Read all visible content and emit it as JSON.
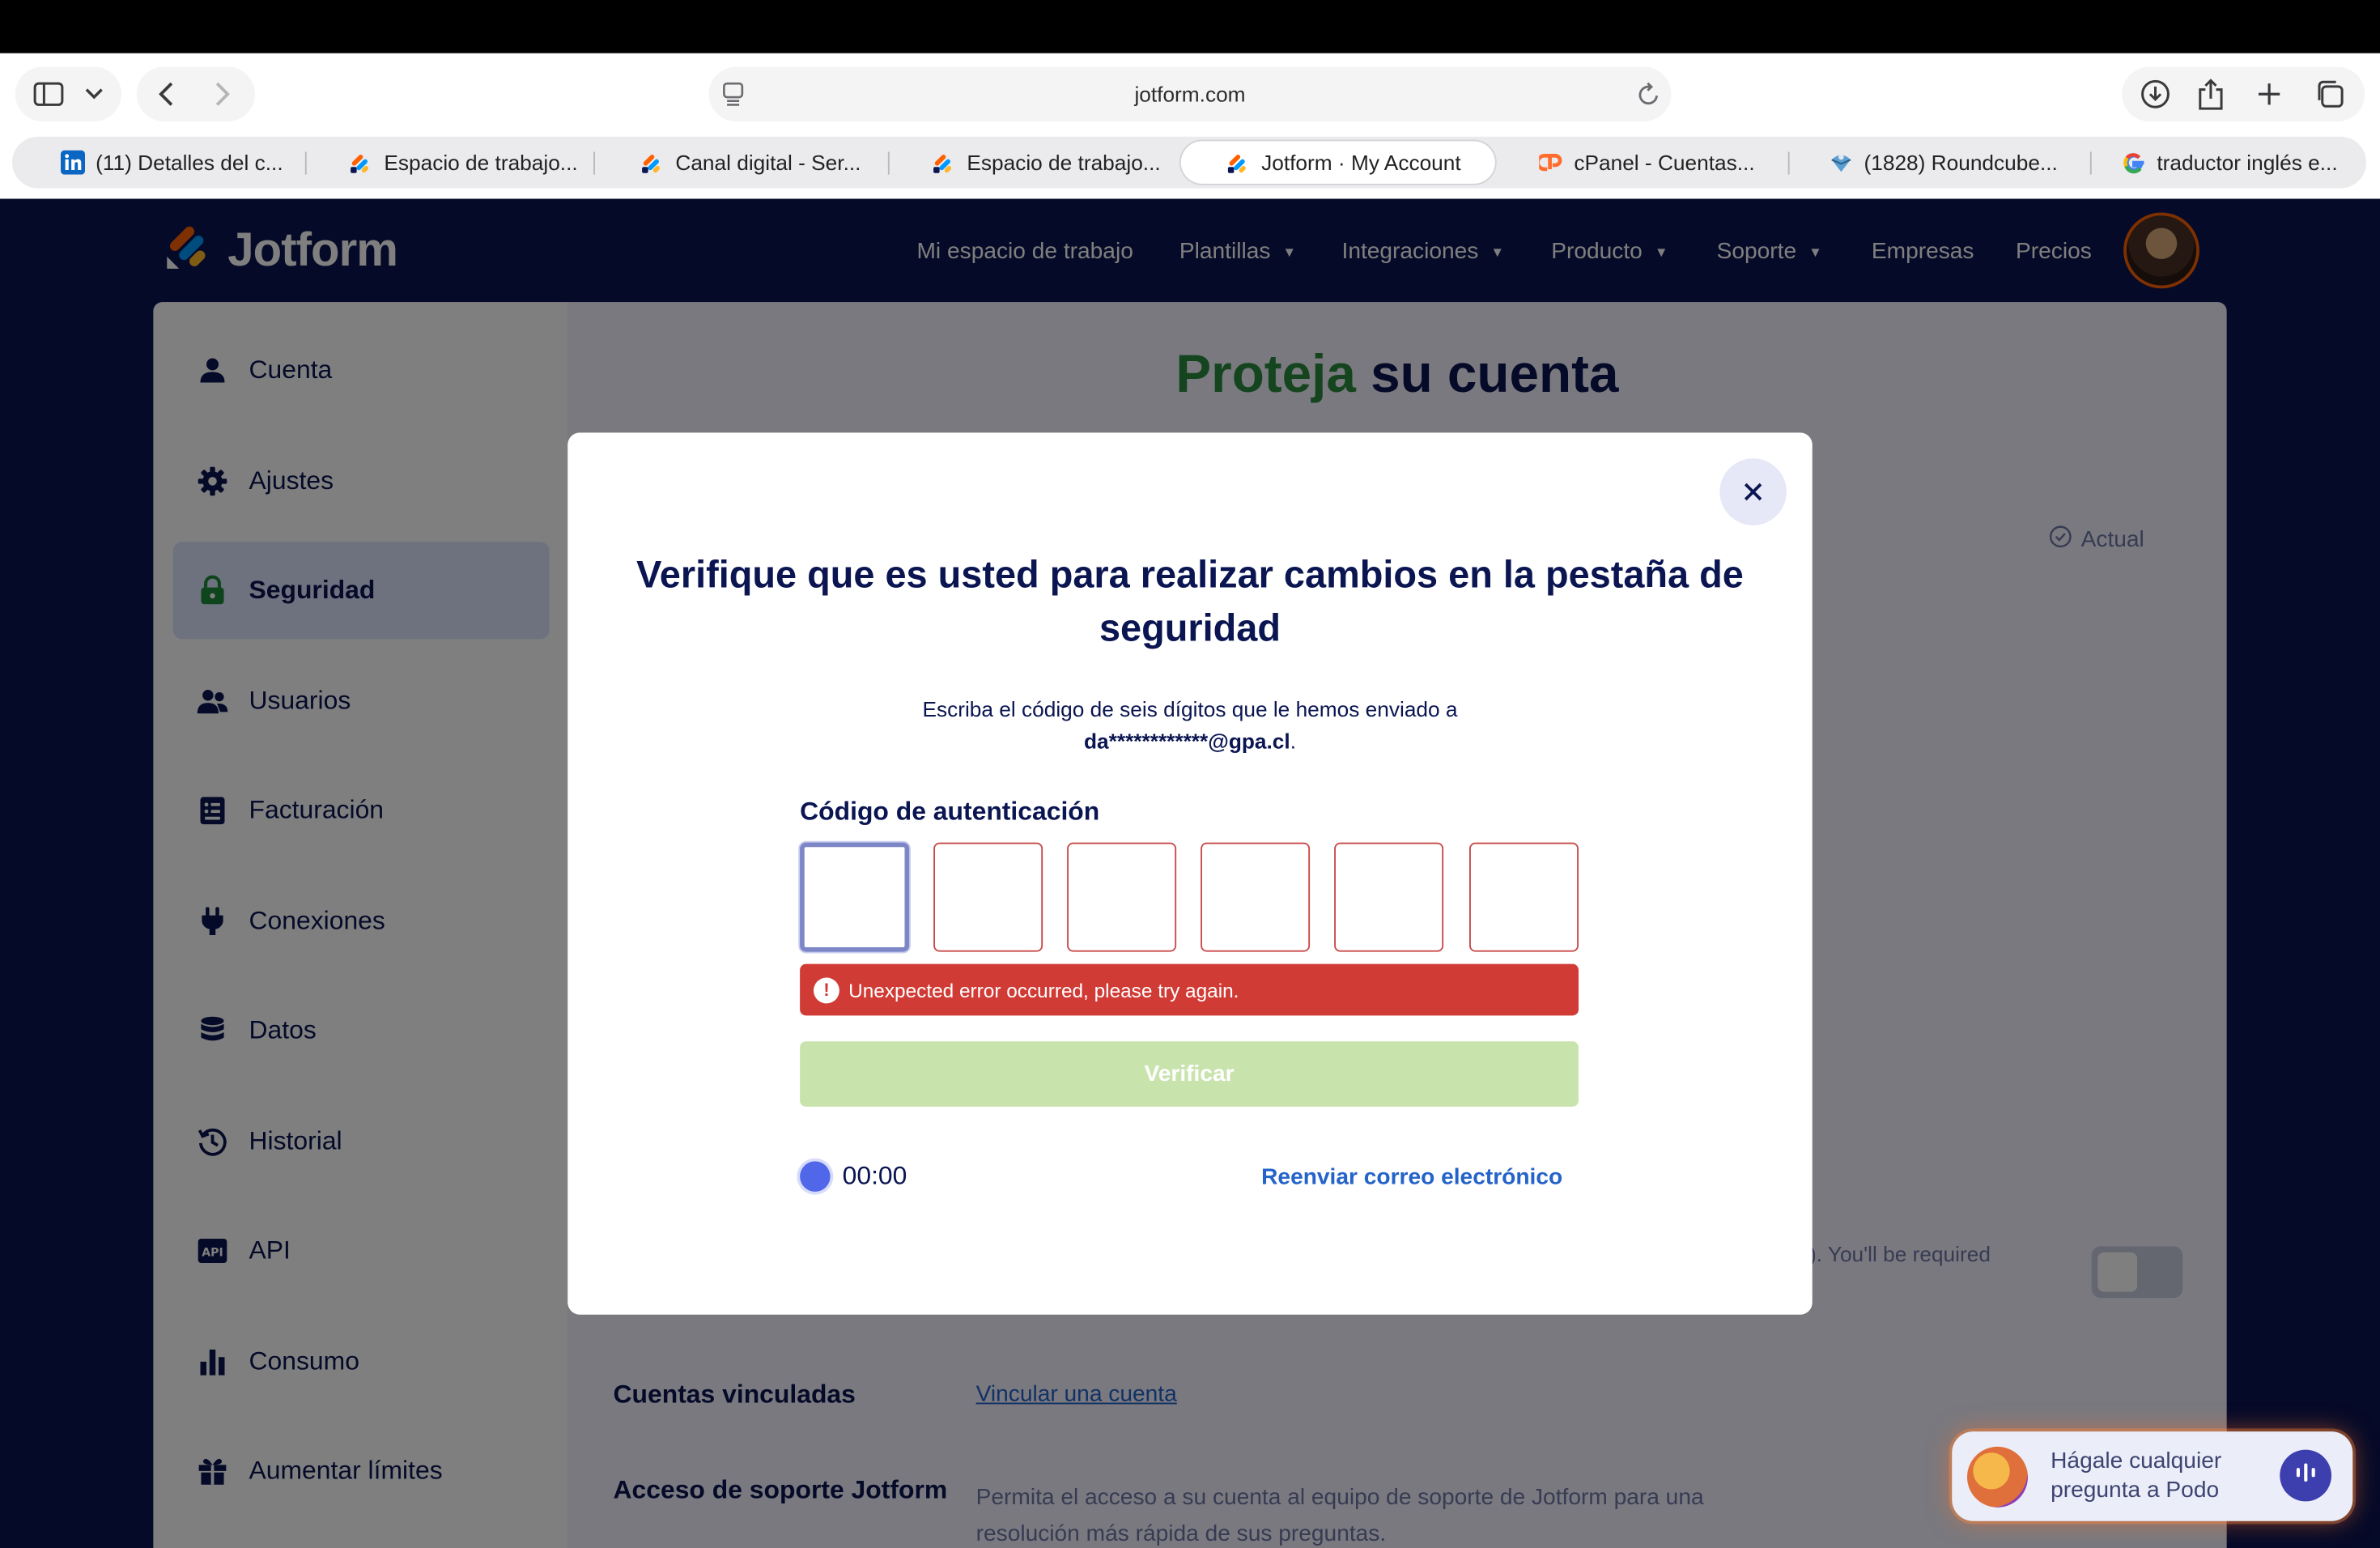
{
  "browser": {
    "url": "jotform.com",
    "tabs": [
      {
        "label": "(11) Detalles del c...",
        "favicon": "linkedin-favicon"
      },
      {
        "label": "Espacio de trabajo...",
        "favicon": "jotform-favicon"
      },
      {
        "label": "Canal digital - Ser...",
        "favicon": "jotform-favicon"
      },
      {
        "label": "Espacio de trabajo...",
        "favicon": "jotform-favicon"
      },
      {
        "label": "Jotform · My Account",
        "favicon": "jotform-favicon",
        "active": true
      },
      {
        "label": "cPanel - Cuentas...",
        "favicon": "cpanel-favicon"
      },
      {
        "label": "(1828) Roundcube...",
        "favicon": "roundcube-favicon"
      },
      {
        "label": "traductor inglés e...",
        "favicon": "google-favicon"
      }
    ]
  },
  "header": {
    "logo": "Jotform",
    "nav": [
      "Mi espacio de trabajo",
      "Plantillas",
      "Integraciones",
      "Producto",
      "Soporte",
      "Empresas",
      "Precios"
    ]
  },
  "sidebar": {
    "items": [
      {
        "label": "Cuenta",
        "icon": "user-icon"
      },
      {
        "label": "Ajustes",
        "icon": "gear-icon"
      },
      {
        "label": "Seguridad",
        "icon": "lock-icon",
        "active": true
      },
      {
        "label": "Usuarios",
        "icon": "users-icon"
      },
      {
        "label": "Facturación",
        "icon": "invoice-icon"
      },
      {
        "label": "Conexiones",
        "icon": "plug-icon"
      },
      {
        "label": "Datos",
        "icon": "database-icon"
      },
      {
        "label": "Historial",
        "icon": "history-icon"
      },
      {
        "label": "API",
        "icon": "api-icon"
      },
      {
        "label": "Consumo",
        "icon": "bar-chart-icon"
      },
      {
        "label": "Aumentar límites",
        "icon": "gift-icon"
      }
    ]
  },
  "main": {
    "title_part1": "Proteja",
    "title_part2": " su cuenta",
    "current_label": "Actual",
    "required_text": "). You'll be required",
    "linked_label": "Cuentas vinculadas",
    "linked_link": "Vincular una cuenta",
    "support_label": "Acceso de soporte Jotform",
    "support_text": "Permita el acceso a su cuenta al equipo de soporte de Jotform para una resolución más rápida de sus preguntas."
  },
  "modal": {
    "title": "Verifique que es usted para realizar cambios en la pestaña de seguridad",
    "description": "Escriba el código de seis dígitos que le hemos enviado a",
    "email": "da************@gpa.cl",
    "email_suffix": ".",
    "code_label": "Código de autenticación",
    "error": "Unexpected error occurred, please try again.",
    "verify_label": "Verificar",
    "timer": "00:00",
    "resend_label": "Reenviar correo electrónico"
  },
  "podo": {
    "line1": "Hágale cualquier",
    "line2": "pregunta a Podo"
  },
  "colors": {
    "brand_navy": "#0a1551",
    "error_red": "#d13b35",
    "verify_disabled": "#c9e3ad",
    "link_blue": "#2463c9",
    "title_green": "#2b8a3e"
  }
}
